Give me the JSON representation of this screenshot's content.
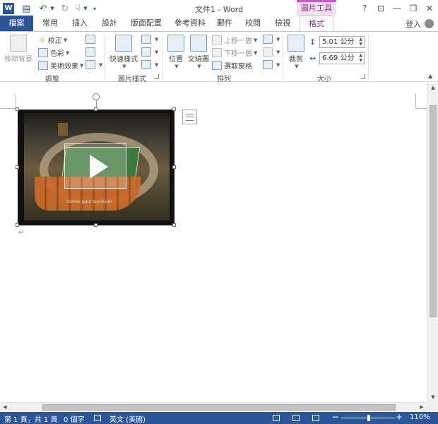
{
  "app": {
    "window_title": "文件1 - Word",
    "context_tab_title": "圖片工具",
    "login": "登入"
  },
  "window_controls": {
    "help": "?",
    "ribbon_display": "⊡",
    "minimize": "—",
    "restore": "❐",
    "close": "✕"
  },
  "tabs": [
    {
      "id": "file",
      "label": "檔案"
    },
    {
      "id": "home",
      "label": "常用"
    },
    {
      "id": "insert",
      "label": "插入"
    },
    {
      "id": "design",
      "label": "設計"
    },
    {
      "id": "layout",
      "label": "版面配置"
    },
    {
      "id": "references",
      "label": "參考資料"
    },
    {
      "id": "mailings",
      "label": "郵件"
    },
    {
      "id": "review",
      "label": "校閱"
    },
    {
      "id": "view",
      "label": "檢視"
    },
    {
      "id": "format",
      "label": "格式"
    }
  ],
  "ribbon": {
    "adjust": {
      "label": "調整",
      "remove_background": "移除背景",
      "corrections": "校正",
      "color": "色彩",
      "artistic_effects": "美術效果"
    },
    "picture_styles": {
      "label": "圖片樣式",
      "quick_styles": "快速樣式"
    },
    "arrange": {
      "label": "排列",
      "position": "位置",
      "wrap_text": "文繞圖",
      "bring_forward": "上移一層",
      "send_backward": "下移一層",
      "selection_pane": "選取窗格"
    },
    "size": {
      "label": "大小",
      "crop": "裁剪",
      "height": "5.01 公分",
      "width": "6.69 公分"
    }
  },
  "video": {
    "caption": "Scores pour soulevier"
  },
  "status": {
    "page": "第 1 頁，共 1 頁",
    "words": "0 個字",
    "language": "英文 (美國)",
    "zoom_minus": "−",
    "zoom_plus": "+",
    "zoom": "110%",
    "zoom_level_percent": 110
  },
  "colors": {
    "accent": "#2b579a",
    "context_accent": "#c75bc7"
  }
}
